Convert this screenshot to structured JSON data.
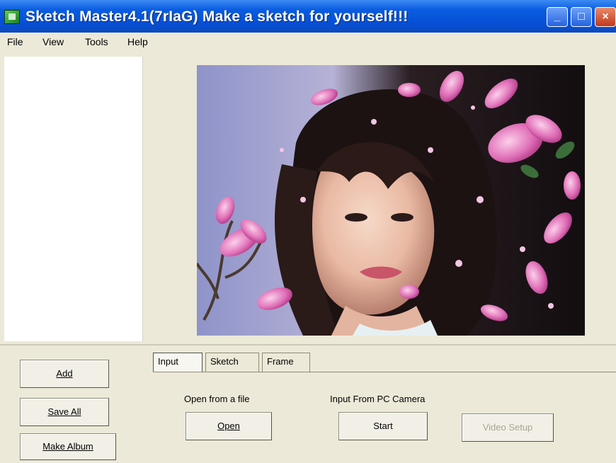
{
  "window": {
    "title": "Sketch Master4.1(7rIaG) Make a sketch for yourself!!!",
    "controls": {
      "minimize": "_",
      "maximize": "□",
      "close": "×"
    }
  },
  "menu": {
    "items": [
      {
        "label": "File"
      },
      {
        "label": "View"
      },
      {
        "label": "Tools"
      },
      {
        "label": "Help"
      }
    ]
  },
  "left_actions": {
    "add_label": "Add",
    "save_all_label": "Save All",
    "make_album_label": "Make Album"
  },
  "tabs": [
    {
      "label": "Input",
      "active": true
    },
    {
      "label": "Sketch",
      "active": false
    },
    {
      "label": "Frame",
      "active": false
    }
  ],
  "input_tab": {
    "open_file_caption": "Open from a file",
    "open_button_label": "Open",
    "camera_caption": "Input From PC Camera",
    "start_button_label": "Start",
    "video_setup_label": "Video Setup"
  },
  "colors": {
    "titlebar": "#0650d6",
    "face_background": "#ece9d8",
    "close_button": "#c1381a"
  }
}
